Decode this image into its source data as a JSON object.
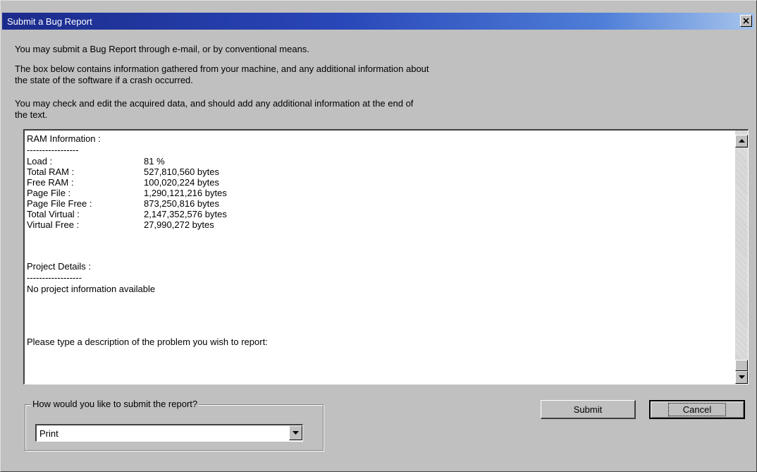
{
  "window": {
    "title": "Submit a Bug Report"
  },
  "intro": {
    "line1": "You may submit a Bug Report through e-mail, or by conventional means.",
    "line2a": "The box below contains information gathered from your machine, and any additional information about",
    "line2b": "the state of the software if a crash occurred.",
    "line3a": "You may check and edit the acquired data, and should add any additional information at the end of",
    "line3b": "the text."
  },
  "report": {
    "ram_title": "RAM Information :",
    "dashes": "-----------------",
    "ram_rows": [
      {
        "key": "Load :",
        "value": "81 %"
      },
      {
        "key": "Total RAM :",
        "value": "527,810,560 bytes"
      },
      {
        "key": "Free RAM :",
        "value": "100,020,224 bytes"
      },
      {
        "key": "Page File :",
        "value": "1,290,121,216 bytes"
      },
      {
        "key": "Page File Free :",
        "value": "873,250,816 bytes"
      },
      {
        "key": "Total Virtual :",
        "value": "2,147,352,576 bytes"
      },
      {
        "key": "Virtual Free :",
        "value": "27,990,272 bytes"
      }
    ],
    "project_title": "Project Details :",
    "project_dashes": "------------------",
    "project_info": "No project information available",
    "prompt": "Please type a description of the problem you wish to report:"
  },
  "submit_group": {
    "legend": "How would you like to submit the report?",
    "selected": "Print"
  },
  "buttons": {
    "submit": "Submit",
    "cancel": "Cancel"
  },
  "colors": {
    "titlebar_start": "#1b2b8c",
    "titlebar_end": "#a6c4ec",
    "face": "#c0c0c0"
  }
}
